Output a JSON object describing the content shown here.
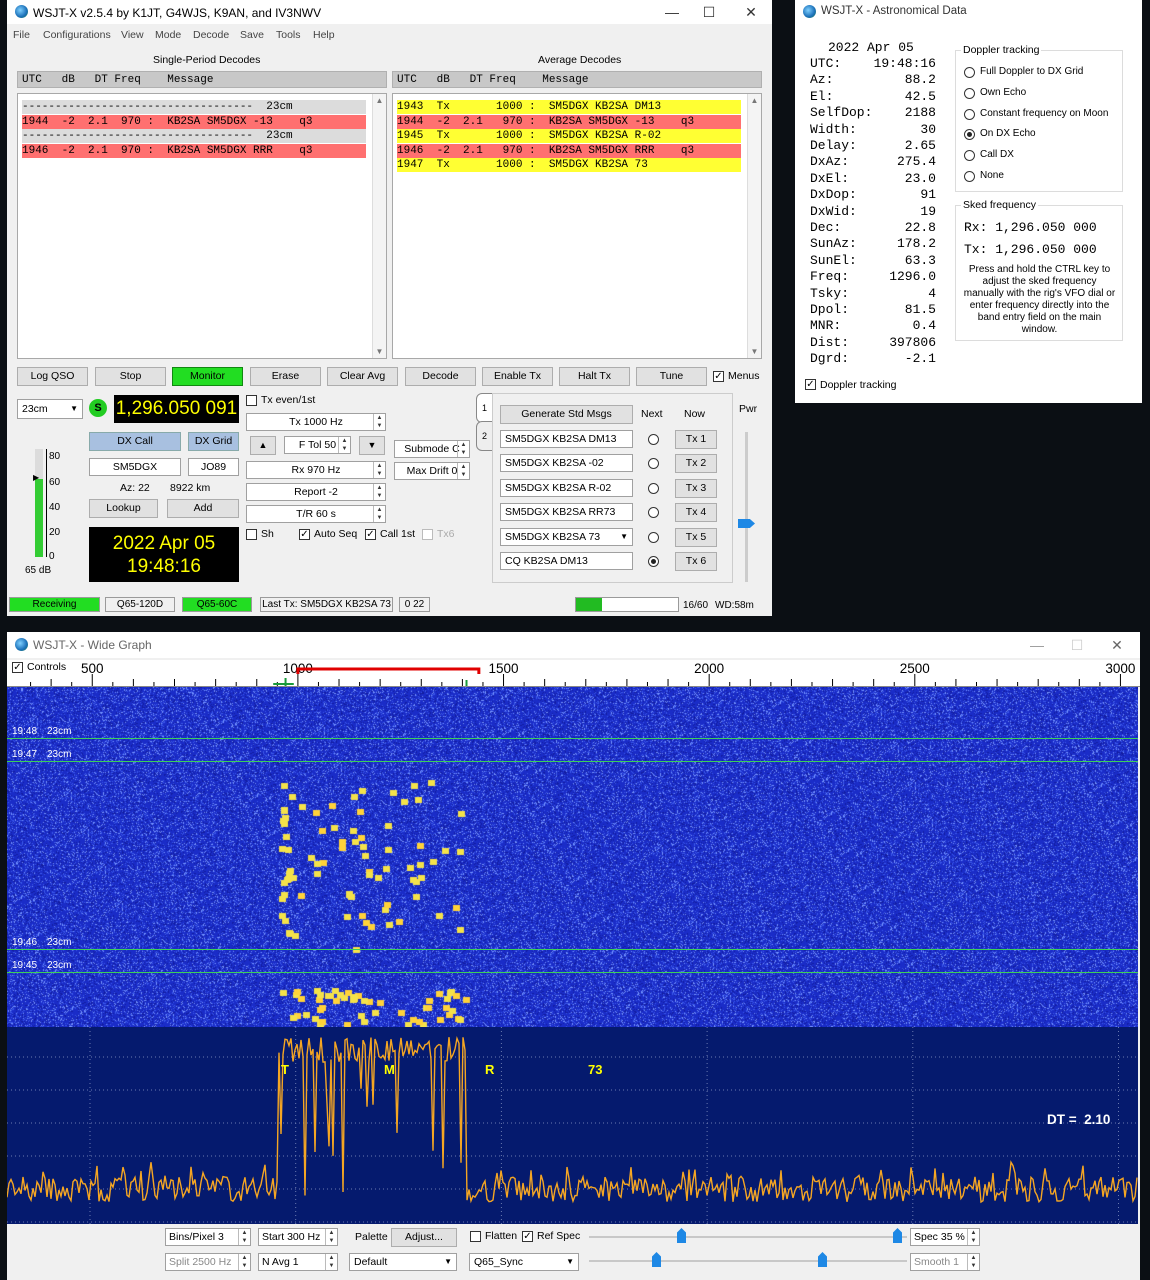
{
  "main": {
    "title": "WSJT-X   v2.5.4   by K1JT, G4WJS, K9AN, and IV3NWV",
    "menu": [
      "File",
      "Configurations",
      "View",
      "Mode",
      "Decode",
      "Save",
      "Tools",
      "Help"
    ],
    "single_label": "Single-Period Decodes",
    "average_label": "Average Decodes",
    "single_header": "UTC   dB   DT Freq    Message",
    "average_header": "UTC   dB   DT Freq    Message",
    "single_lines": [
      {
        "text": "-----------------------------------  23cm",
        "bg": "#dcdcdc"
      },
      {
        "text": "1944  -2  2.1  970 :  KB2SA SM5DGX -13    q3",
        "bg": "#ff7070"
      },
      {
        "text": "-----------------------------------  23cm",
        "bg": "#dcdcdc"
      },
      {
        "text": "1946  -2  2.1  970 :  KB2SA SM5DGX RRR    q3",
        "bg": "#ff7070"
      }
    ],
    "average_lines": [
      {
        "text": "1943  Tx       1000 :  SM5DGX KB2SA DM13",
        "bg": "#ffff33"
      },
      {
        "text": "1944  -2  2.1   970 :  KB2SA SM5DGX -13    q3",
        "bg": "#ff7070"
      },
      {
        "text": "1945  Tx       1000 :  SM5DGX KB2SA R-02",
        "bg": "#ffff33"
      },
      {
        "text": "1946  -2  2.1   970 :  KB2SA SM5DGX RRR    q3",
        "bg": "#ff7070"
      },
      {
        "text": "1947  Tx       1000 :  SM5DGX KB2SA 73",
        "bg": "#ffff33"
      }
    ],
    "buttons": {
      "log_qso": "Log QSO",
      "stop": "Stop",
      "monitor": "Monitor",
      "erase": "Erase",
      "clear_avg": "Clear Avg",
      "decode": "Decode",
      "enable_tx": "Enable Tx",
      "halt_tx": "Halt Tx",
      "tune": "Tune",
      "menus": "Menus"
    },
    "band": "23cm",
    "s_badge": "S",
    "frequency": "1,296.050 091",
    "dx_call_label": "DX Call",
    "dx_grid_label": "DX Grid",
    "dx_call": "SM5DGX",
    "dx_grid": "JO89",
    "az_text": "Az: 22",
    "dist_text": "8922 km",
    "lookup": "Lookup",
    "add": "Add",
    "date": "2022 Apr 05",
    "time": "19:48:16",
    "meter_ticks": [
      "80",
      "60",
      "40",
      "20",
      "0"
    ],
    "meter_db": "65 dB",
    "tx_even": "Tx even/1st",
    "tx_freq": "Tx  1000  Hz",
    "ftol": "F Tol  50",
    "rx_freq": "Rx  970  Hz",
    "report": "Report  -2",
    "tr": "T/R  60  s",
    "submode": "Submode  C",
    "max_drift": "Max Drift  0",
    "sh": "Sh",
    "auto_seq": "Auto Seq",
    "call_1st": "Call 1st",
    "tx6_chk": "Tx6",
    "tab1": "1",
    "tab2": "2",
    "gen_std": "Generate Std Msgs",
    "next_label": "Next",
    "now_label": "Now",
    "pwr_label": "Pwr",
    "tx_msgs": [
      "SM5DGX KB2SA DM13",
      "SM5DGX KB2SA -02",
      "SM5DGX KB2SA R-02",
      "SM5DGX KB2SA RR73",
      "SM5DGX KB2SA 73",
      "CQ KB2SA DM13"
    ],
    "tx_buttons": [
      "Tx 1",
      "Tx 2",
      "Tx 3",
      "Tx 4",
      "Tx 5",
      "Tx 6"
    ],
    "status": {
      "receiving": "Receiving",
      "mode1": "Q65-120D",
      "mode2": "Q65-60C",
      "last_tx": "Last Tx: SM5DGX KB2SA 73",
      "count": "0  22",
      "progress": "16/60",
      "wd": "WD:58m"
    },
    "progress_fraction": 0.25
  },
  "astro": {
    "title": "WSJT-X - Astronomical Data",
    "date": "2022 Apr 05",
    "rows": [
      [
        "UTC:",
        "19:48:16"
      ],
      [
        "Az:",
        "88.2"
      ],
      [
        "El:",
        "42.5"
      ],
      [
        "SelfDop:",
        "2188"
      ],
      [
        "Width:",
        "30"
      ],
      [
        "Delay:",
        "2.65"
      ],
      [
        "DxAz:",
        "275.4"
      ],
      [
        "DxEl:",
        "23.0"
      ],
      [
        "DxDop:",
        "91"
      ],
      [
        "DxWid:",
        "19"
      ],
      [
        "Dec:",
        "22.8"
      ],
      [
        "SunAz:",
        "178.2"
      ],
      [
        "SunEl:",
        "63.3"
      ],
      [
        "Freq:",
        "1296.0"
      ],
      [
        "Tsky:",
        "4"
      ],
      [
        "Dpol:",
        "81.5"
      ],
      [
        "MNR:",
        "0.4"
      ],
      [
        "Dist:",
        "397806"
      ],
      [
        "Dgrd:",
        "-2.1"
      ]
    ],
    "doppler_title": "Doppler tracking",
    "doppler_options": [
      "Full Doppler to DX Grid",
      "Own Echo",
      "Constant frequency on Moon",
      "On DX Echo",
      "Call DX",
      "None"
    ],
    "doppler_selected": 3,
    "sked_title": "Sked frequency",
    "sked_rx": "Rx: 1,296.050 000",
    "sked_tx": "Tx: 1,296.050 000",
    "sked_note": "Press and hold the CTRL key to adjust the sked frequency manually with the rig's VFO dial or enter frequency directly into the band entry field on the main window.",
    "doppler_chk": "Doppler tracking"
  },
  "wide": {
    "title": "WSJT-X - Wide Graph",
    "controls": "Controls",
    "scale_labels": [
      "500",
      "1000",
      "1500",
      "2000",
      "2500",
      "3000"
    ],
    "scale_values": [
      500,
      1000,
      1500,
      2000,
      2500,
      3000
    ],
    "scale_min": 300,
    "scale_max": 3050,
    "time_marks": [
      [
        "19:48",
        "23cm"
      ],
      [
        "19:47",
        "23cm"
      ],
      [
        "19:46",
        "23cm"
      ],
      [
        "19:45",
        "23cm"
      ]
    ],
    "spec_marks": [
      "T",
      "M",
      "R",
      "73"
    ],
    "dt_label": "DT =  2.10",
    "bins": "Bins/Pixel  3",
    "start": "Start  300 Hz",
    "split": "Split  2500  Hz",
    "navg": "N Avg  1",
    "palette": "Palette",
    "adjust": "Adjust...",
    "palette_val": "Default",
    "flatten": "Flatten",
    "ref_spec": "Ref Spec",
    "mode_sel": "Q65_Sync",
    "spec_pct": "Spec  35  %",
    "smooth": "Smooth  1"
  },
  "colors": {
    "decode_red": "#ff7070",
    "decode_yellow": "#ffff33",
    "monitor_green": "#22dd22",
    "freq_yellow": "#ffff00",
    "waterfall_blue": "#1c30c8",
    "spectrum_orange": "#f5a623"
  }
}
